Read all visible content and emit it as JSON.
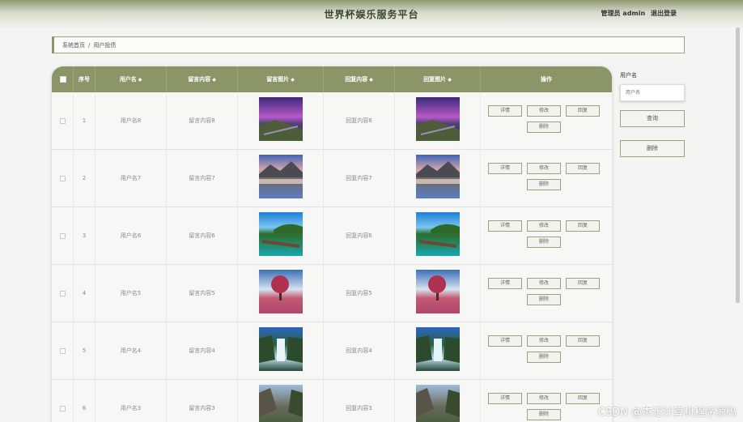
{
  "header": {
    "title": "世界杯娱乐服务平台",
    "admin": "管理员 admin",
    "logout": "退出登录"
  },
  "breadcrumb": {
    "home": "系统首页",
    "sep": "/",
    "current": "用户投债"
  },
  "table": {
    "headers": {
      "index": "序号",
      "username": "用户名",
      "content": "留言内容",
      "image": "留言图片",
      "reply": "回复内容",
      "reply_image": "回复图片",
      "actions": "操作"
    },
    "sort_icon": "◆",
    "buttons": {
      "detail": "详情",
      "edit": "修改",
      "reply": "回复",
      "delete": "删除"
    },
    "rows": [
      {
        "index": "1",
        "username": "用户名8",
        "content": "留言内容8",
        "reply": "回复内容8",
        "image": "purple-sunset-cliffs"
      },
      {
        "index": "2",
        "username": "用户名7",
        "content": "留言内容7",
        "reply": "回复内容7",
        "image": "mountain-lake-reflection"
      },
      {
        "index": "3",
        "username": "用户名6",
        "content": "留言内容6",
        "reply": "回复内容6",
        "image": "tropical-pier-island"
      },
      {
        "index": "4",
        "username": "用户名5",
        "content": "留言内容5",
        "reply": "回复内容5",
        "image": "pink-tree-field"
      },
      {
        "index": "5",
        "username": "用户名4",
        "content": "留言内容4",
        "reply": "回复内容4",
        "image": "waterfall-cliffs"
      },
      {
        "index": "6",
        "username": "用户名3",
        "content": "留言内容3",
        "reply": "回复内容3",
        "image": "rocky-mountain-valley"
      }
    ]
  },
  "search": {
    "label": "用户名",
    "placeholder": "用户名",
    "search_button": "查询",
    "delete_button": "删除"
  },
  "watermark": "CSDN @杰记计算机程序源码"
}
